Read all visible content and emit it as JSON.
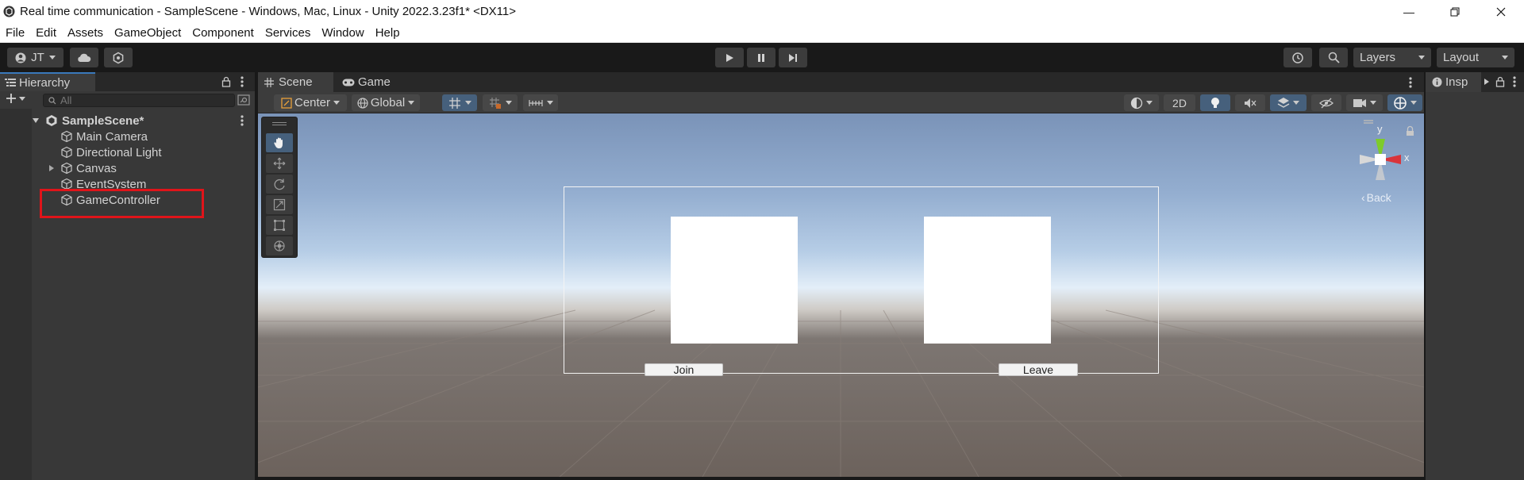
{
  "window": {
    "title": "Real time communication - SampleScene - Windows, Mac, Linux - Unity 2022.3.23f1* <DX11>"
  },
  "menu": [
    "File",
    "Edit",
    "Assets",
    "GameObject",
    "Component",
    "Services",
    "Window",
    "Help"
  ],
  "toolbar": {
    "account_label": "JT",
    "layers_label": "Layers",
    "layout_label": "Layout"
  },
  "hierarchy": {
    "tab_label": "Hierarchy",
    "search_placeholder": "All",
    "scene_name": "SampleScene*",
    "items": [
      {
        "label": "Main Camera"
      },
      {
        "label": "Directional Light"
      },
      {
        "label": "Canvas"
      },
      {
        "label": "EventSystem"
      },
      {
        "label": "GameController"
      }
    ]
  },
  "scene": {
    "tabs": [
      {
        "label": "Scene"
      },
      {
        "label": "Game"
      }
    ],
    "pivot_label": "Center",
    "space_label": "Global",
    "mode_2d_label": "2D",
    "gizmo": {
      "y_label": "y",
      "x_label": "x",
      "back_label": "Back"
    },
    "ui_buttons": {
      "join_label": "Join",
      "leave_label": "Leave"
    }
  },
  "inspector": {
    "tab_label": "Insp"
  },
  "colors": {
    "highlight_box": "#e0141a",
    "tab_accent": "#3a79bb"
  }
}
